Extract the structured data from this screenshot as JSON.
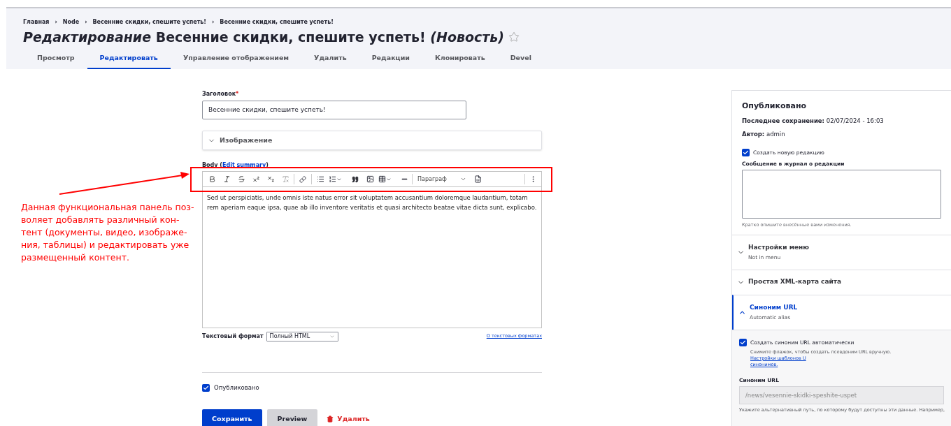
{
  "breadcrumbs": [
    {
      "label": "Главная"
    },
    {
      "separator": "›",
      "label": "Node"
    },
    {
      "separator": "›",
      "label": "Весенние скидки, спешите успеть!"
    },
    {
      "separator": "›",
      "label": "Весенние скидки, спешите успеть!"
    }
  ],
  "page_title": "*Редактирование* Весенние скидки, спешите успеть! *(Новость)*",
  "tabs": [
    {
      "label": "Просмотр",
      "selected": false
    },
    {
      "label": "Редактировать",
      "selected": true
    },
    {
      "label": "Управление отображением",
      "selected": false
    },
    {
      "label": "Удалить",
      "selected": false
    },
    {
      "label": "Редакции",
      "selected": false
    },
    {
      "label": "Клонировать",
      "selected": false
    },
    {
      "label": "Devel",
      "selected": false
    }
  ],
  "form": {
    "title_field": {
      "label": "Заголовок",
      "required_mark": "*",
      "value": "Весенние скидки, спешите успеть!"
    },
    "image_section": {
      "label": "Изображение",
      "expanded": false
    },
    "body": {
      "label": "Body (",
      "link": "Edit summary",
      "label_end": ")",
      "paragraph_style": "Параграф",
      "text": "Sed ut perspiciatis, unde omnis iste natus error sit voluptatem accusantium doloremque laudantium, totam rem aperiam eaque ipsa, quae ab illo inventore veritatis et quasi architecto beatae vitae dicta sunt, explicabo."
    },
    "text_format": {
      "label": "Текстовый формат",
      "value": "Полный HTML",
      "help_link": "О текстовых форматах"
    },
    "published": {
      "label": "Опубликовано",
      "checked": true
    },
    "buttons": [
      {
        "label": "Сохранить",
        "kind": "primary"
      },
      {
        "label": "Preview",
        "kind": "secondary"
      },
      {
        "label": "Удалить",
        "kind": "danger"
      }
    ]
  },
  "annotation": {
    "lines": [
      "Данная функциональная панель поз-",
      "воляет добавлять различный кон-",
      "тент (документы, видео, изображе-",
      "ния, таблицы) и редактировать уже",
      "размещенный контент."
    ]
  },
  "sidebar": {
    "status": "Опубликовано",
    "last_saved_label": "Последнее сохранение:",
    "last_saved": "02/07/2024 - 16:03",
    "author_label": "Автор:",
    "author": "admin",
    "new_revision": {
      "label": "Создать новую редакцию",
      "checked": true
    },
    "log_label": "Сообщение в журнал о редакции",
    "log_hint": "Кратко опишите внесённые вами изменения.",
    "sections": [
      {
        "title": "Настройки меню",
        "summary": "Not in menu",
        "expanded": false
      },
      {
        "title": "Простая XML-карта сайта",
        "expanded": false
      },
      {
        "title": "Синоним URL",
        "summary": "Automatic alias",
        "expanded": true
      }
    ],
    "url_alias": {
      "checkbox": {
        "label": "Создать синоним URL автоматически",
        "checked": true
      },
      "hint": "Снимите флажок, чтобы создать псевдоним URL вручную.",
      "hint_link": "Настройки шаблонов U",
      "hint_link_end": "синонимов.",
      "field_label": "Синоним URL",
      "value": "/news/vesennie-skidki-speshite-uspet",
      "disabled": true,
      "field_hint": "Укажите альтернативный путь, по которому будут доступны эти данные. Например,"
    }
  }
}
